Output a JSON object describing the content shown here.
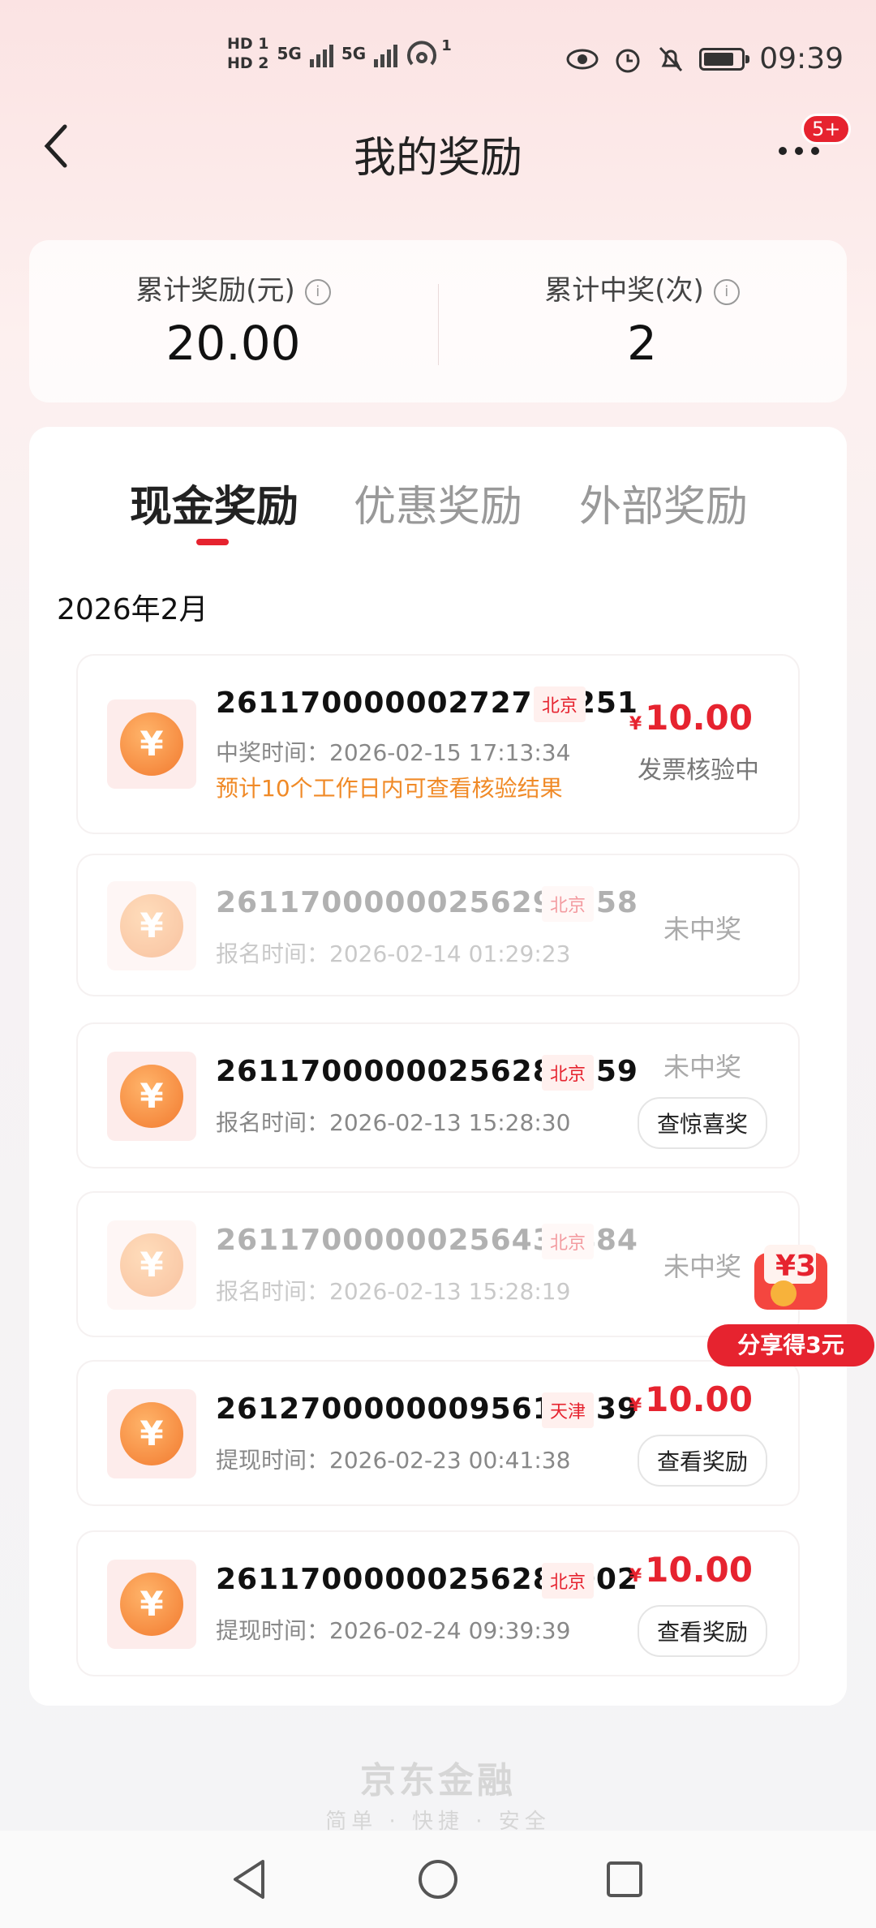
{
  "status_bar": {
    "hd1": "HD 1",
    "hd2": "HD 2",
    "net1": "5G",
    "net2": "5G",
    "hotspot_count": "1",
    "time": "09:39"
  },
  "header": {
    "title": "我的奖励",
    "more_badge": "5+"
  },
  "summary": {
    "total_reward_label": "累计奖励(元)",
    "total_reward_value": "20.00",
    "total_wins_label": "累计中奖(次)",
    "total_wins_value": "2"
  },
  "tabs": [
    {
      "label": "现金奖励",
      "active": true
    },
    {
      "label": "优惠奖励",
      "active": false
    },
    {
      "label": "外部奖励",
      "active": false
    }
  ],
  "month": "2026年2月",
  "records": [
    {
      "number": "26117000000272779251",
      "location": "北京",
      "time": "中奖时间：2026-02-15 17:13:34",
      "hint": "预计10个工作日内可查看核验结果",
      "currency": "¥",
      "amount": "10.00",
      "status": "发票核验中"
    },
    {
      "number": "26117000000256299858",
      "location": "北京",
      "time": "报名时间：2026-02-14 01:29:23",
      "status": "未中奖"
    },
    {
      "number": "26117000000256289359",
      "location": "北京",
      "time": "报名时间：2026-02-13 15:28:30",
      "status": "未中奖",
      "button": "查惊喜奖"
    },
    {
      "number": "26117000000256434484",
      "location": "北京",
      "time": "报名时间：2026-02-13 15:28:19",
      "status": "未中奖"
    },
    {
      "number": "26127000000095618239",
      "location": "天津",
      "time": "提现时间：2026-02-23 00:41:38",
      "currency": "¥",
      "amount": "10.00",
      "button": "查看奖励"
    },
    {
      "number": "26117000000256288002",
      "location": "北京",
      "time": "提现时间：2026-02-24 09:39:39",
      "currency": "¥",
      "amount": "10.00",
      "button": "查看奖励"
    }
  ],
  "share": {
    "gift_amount": "¥3",
    "label": "分享得3元"
  },
  "footer": {
    "brand": "京东金融",
    "slogan": "简单 · 快捷 · 安全"
  },
  "colors": {
    "accent": "#e6232f",
    "hint": "#f08a27"
  }
}
